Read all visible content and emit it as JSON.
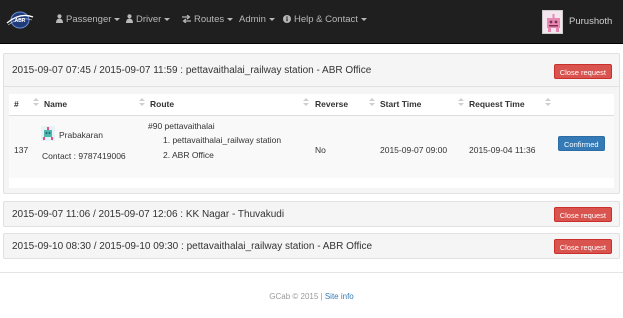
{
  "navbar": {
    "logo_text": "ABR",
    "items": [
      {
        "label": "Passenger",
        "icon": "user-icon"
      },
      {
        "label": "Driver",
        "icon": "user-icon"
      },
      {
        "label": "Routes",
        "icon": "routes-arrows-icon"
      },
      {
        "label": "Admin",
        "icon": ""
      },
      {
        "label": "Help & Contact",
        "icon": "info-circle-icon"
      }
    ],
    "user_name": "Purushoth",
    "brand_color": "#1f1f1f"
  },
  "requests": [
    {
      "title": "2015-09-07 07:45 / 2015-09-07 11:59 : pettavaithalai_railway station - ABR Office",
      "close_label": "Close request",
      "expanded": true,
      "table": {
        "headers": [
          "#",
          "Name",
          "Route",
          "Reverse",
          "Start Time",
          "Request Time"
        ],
        "row": {
          "id": "137",
          "name": "Prabakaran",
          "contact": "Contact : 9787419006",
          "route_no": "#90 pettavaithalai",
          "stop_1": "1. pettavaithalai_railway station",
          "stop_2": "2. ABR Office",
          "reverse": "No",
          "start_time": "2015-09-07 09:00",
          "request_time": "2015-09-04 11:36",
          "status_label": "Confirmed"
        }
      }
    },
    {
      "title": "2015-09-07 11:06 / 2015-09-07 12:06 : KK Nagar - Thuvakudi",
      "close_label": "Close request",
      "expanded": false
    },
    {
      "title": "2015-09-10 08:30 / 2015-09-10 09:30 : pettavaithalai_railway station - ABR Office",
      "close_label": "Close request",
      "expanded": false
    }
  ],
  "footer": {
    "copyright": "GCab © 2015 |",
    "link": "Site info"
  },
  "colors": {
    "danger": "#d9534f",
    "primary": "#337ab7",
    "panel_bg": "#f5f5f5"
  }
}
